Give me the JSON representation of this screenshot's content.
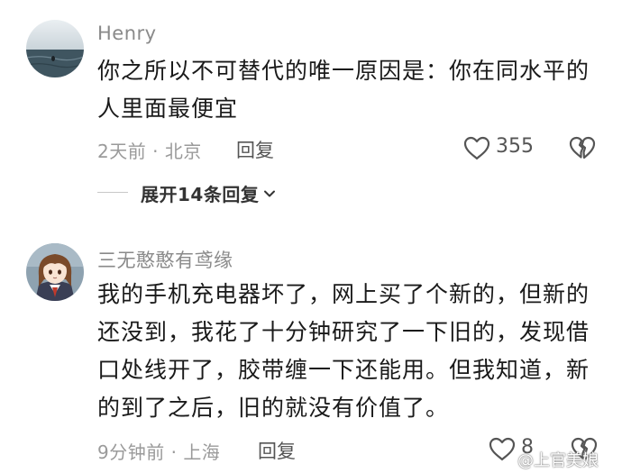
{
  "comments": [
    {
      "username": "Henry",
      "lines": [
        "你之所以不可替代的唯一原因是：你在同水平的",
        "人里面最便宜"
      ],
      "time": "2天前",
      "location": "北京",
      "reply_label": "回复",
      "likes": "355"
    },
    {
      "username": "三无憨憨有鸢缘",
      "lines": [
        "我的手机充电器坏了，网上买了个新的，但新的",
        "还没到，我花了十分钟研究了一下旧的，发现借",
        "口处线开了，胶带缠一下还能用。但我知道，新",
        "的到了之后，旧的就没有价值了。"
      ],
      "time": "9分钟前",
      "location": "上海",
      "reply_label": "回复",
      "likes": "8"
    }
  ],
  "expand_replies": "展开14条回复",
  "meta_separator": "·",
  "watermark": "@上官美娘",
  "icons": [
    "heart-icon",
    "broken-heart-icon",
    "chevron-down-icon"
  ]
}
